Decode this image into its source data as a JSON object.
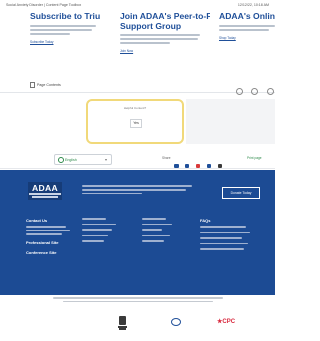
{
  "browser": {
    "page_title": "Social Anxiety Disorder | Content Page Toolbox",
    "date": "12/12/22, 10:18 AM"
  },
  "cards": [
    {
      "title_lines": [
        "Subscribe to Triumph"
      ],
      "link": "Subscribe Today"
    },
    {
      "title_lines": [
        "Join ADAA's Peer-to-Peer",
        "Support Group"
      ],
      "link": "Join Now"
    },
    {
      "title_lines": [
        "ADAA's Online S"
      ],
      "link": "Shop Today"
    }
  ],
  "share_row": {
    "label": "Page Contents"
  },
  "feedback": {
    "title": "Helpful Content?",
    "button": "Yes"
  },
  "language": {
    "selected": "English",
    "chevron": "▾"
  },
  "social": {
    "label": "Share"
  },
  "print": {
    "label": "Print page"
  },
  "footer": {
    "logo_text": "ADAA",
    "donate": "Donate Today",
    "contact_title": "Contact Us",
    "professional": "Professional Site",
    "conference": "Conference Site",
    "faqs_title": "FAQs"
  },
  "colors": {
    "footer_bg": "#1c4b94",
    "link_blue": "#1f4f99",
    "accent_yellow": "#f1d97a",
    "accent_green": "#2d8a4a"
  }
}
